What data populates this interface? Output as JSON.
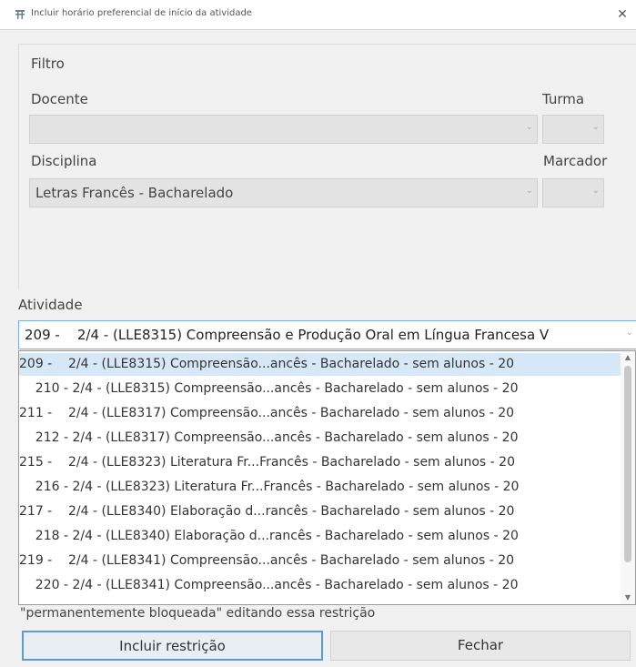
{
  "window": {
    "title": "Incluir horário preferencial de início da atividade",
    "close_glyph": "✕"
  },
  "filter": {
    "legend": "Filtro",
    "docente": {
      "label": "Docente",
      "value": ""
    },
    "turma": {
      "label": "Turma",
      "value": ""
    },
    "disciplina": {
      "label": "Disciplina",
      "value": "Letras Francês - Bacharelado"
    },
    "marcador": {
      "label": "Marcador",
      "value": ""
    }
  },
  "atividade": {
    "label": "Atividade",
    "selected": "209 -    2/4 - (LLE8315) Compreensão e Produção Oral em Língua Francesa V",
    "options": [
      "209 -    2/4 - (LLE8315) Compreensão...ancês - Bacharelado - sem alunos - 20",
      "    210 - 2/4 - (LLE8315) Compreensão...ancês - Bacharelado - sem alunos - 20",
      "211 -    2/4 - (LLE8317) Compreensão...ancês - Bacharelado - sem alunos - 20",
      "    212 - 2/4 - (LLE8317) Compreensão...ancês - Bacharelado - sem alunos - 20",
      "215 -    2/4 - (LLE8323) Literatura Fr...Francês - Bacharelado - sem alunos - 20",
      "    216 - 2/4 - (LLE8323) Literatura Fr...Francês - Bacharelado - sem alunos - 20",
      "217 -    2/4 - (LLE8340) Elaboração d...rancês - Bacharelado - sem alunos - 20",
      "    218 - 2/4 - (LLE8340) Elaboração d...rancês - Bacharelado - sem alunos - 20",
      "219 -    2/4 - (LLE8341) Compreensão...ancês - Bacharelado - sem alunos - 20",
      "    220 - 2/4 - (LLE8341) Compreensão...ancês - Bacharelado - sem alunos - 20"
    ]
  },
  "hint": "\"permanentemente bloqueada\" editando essa restrição",
  "buttons": {
    "include": "Incluir restrição",
    "close": "Fechar"
  },
  "icons": {
    "dropdown": "chevron-down-icon",
    "scroll_up": "scroll-up-icon",
    "scroll_down": "scroll-down-icon",
    "app": "timetable-icon"
  }
}
